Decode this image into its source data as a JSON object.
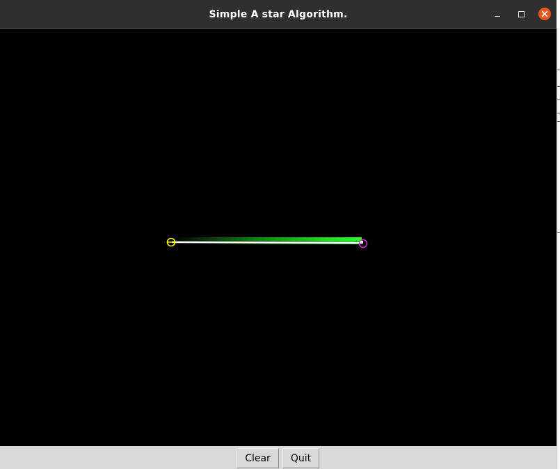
{
  "window": {
    "title": "Simple A star Algorithm."
  },
  "controls": {
    "clear_label": "Clear",
    "quit_label": "Quit"
  },
  "canvas": {
    "background": "#000000",
    "start_marker_color": "#ffff00",
    "goal_marker_color": "#cc33cc",
    "path_color": "#ffffff",
    "explored_color": "#22ff22"
  },
  "colors": {
    "titlebar": "#2f2f2f",
    "close_button": "#e95420",
    "button_face": "#d9d9d9"
  }
}
